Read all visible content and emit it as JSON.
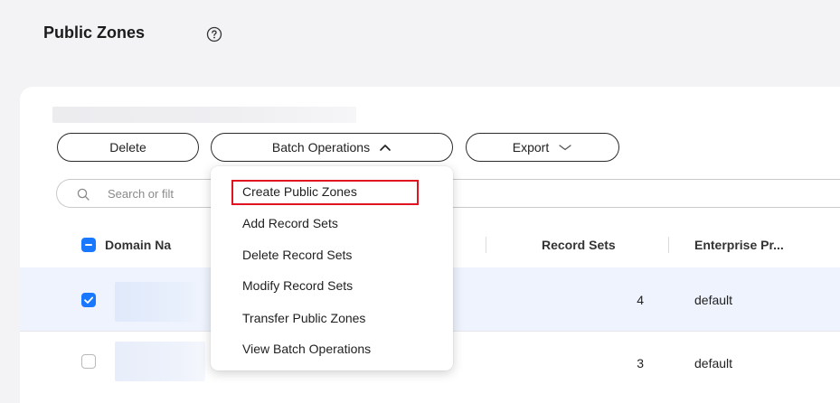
{
  "page": {
    "title": "Public Zones"
  },
  "toolbar": {
    "delete_label": "Delete",
    "batch_label": "Batch Operations",
    "export_label": "Export"
  },
  "search": {
    "placeholder": "Search or filt"
  },
  "table": {
    "columns": [
      "Domain Na",
      "Record Sets",
      "Enterprise Pr..."
    ],
    "rows": [
      {
        "record_sets": "4",
        "enterprise_project": "default",
        "selected": true
      },
      {
        "record_sets": "3",
        "enterprise_project": "default",
        "selected": false
      }
    ]
  },
  "batch_menu": {
    "items": [
      "Create Public Zones",
      "Add Record Sets",
      "Delete Record Sets",
      "Modify Record Sets",
      "Transfer Public Zones",
      "View Batch Operations"
    ],
    "highlighted_item": "Create Public Zones"
  },
  "colors": {
    "accent": "#1878ff",
    "highlight_border": "#e0141e",
    "selected_row_bg": "#eef3fd"
  },
  "icons": [
    "help-icon",
    "chevron-up-icon",
    "chevron-down-icon",
    "search-icon",
    "check-icon"
  ]
}
